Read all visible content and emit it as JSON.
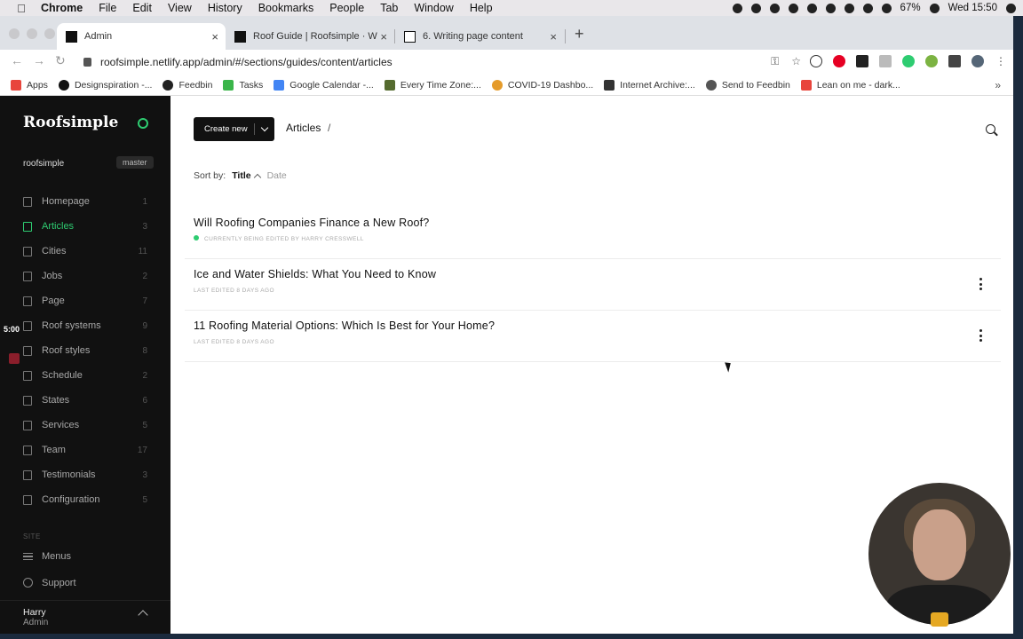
{
  "menubar": {
    "app": "Chrome",
    "items": [
      "File",
      "Edit",
      "View",
      "History",
      "Bookmarks",
      "People",
      "Tab",
      "Window",
      "Help"
    ],
    "battery": "67%",
    "clock": "Wed 15:50"
  },
  "tabs": [
    {
      "label": "Admin",
      "icon": "netlify-black-icon",
      "active": true
    },
    {
      "label": "Roof Guide | Roofsimple · We a",
      "icon": "roofsimple-icon",
      "active": false
    },
    {
      "label": "6. Writing page content",
      "icon": "notion-icon",
      "active": false
    }
  ],
  "omnibox": {
    "url": "roofsimple.netlify.app/admin/#/sections/guides/content/articles"
  },
  "bookmarks": [
    {
      "label": "Apps",
      "color": "#e8453c"
    },
    {
      "label": "Designspiration -...",
      "color": "#111111"
    },
    {
      "label": "Feedbin",
      "color": "#222222"
    },
    {
      "label": "Tasks",
      "color": "#3ab54a"
    },
    {
      "label": "Google Calendar -...",
      "color": "#4285f4"
    },
    {
      "label": "Every Time Zone:...",
      "color": "#556b2f"
    },
    {
      "label": "COVID-19 Dashbo...",
      "color": "#e59b2a"
    },
    {
      "label": "Internet Archive:...",
      "color": "#333333"
    },
    {
      "label": "Send to Feedbin",
      "color": "#555555"
    },
    {
      "label": "Lean on me - dark...",
      "color": "#e8453c"
    }
  ],
  "sidebar": {
    "logo": "Roofsimple",
    "site": "roofsimple",
    "branch": "master",
    "items": [
      {
        "label": "Homepage",
        "count": "1",
        "active": false
      },
      {
        "label": "Articles",
        "count": "3",
        "active": true
      },
      {
        "label": "Cities",
        "count": "11",
        "active": false
      },
      {
        "label": "Jobs",
        "count": "2",
        "active": false
      },
      {
        "label": "Page",
        "count": "7",
        "active": false
      },
      {
        "label": "Roof systems",
        "count": "9",
        "active": false
      },
      {
        "label": "Roof styles",
        "count": "8",
        "active": false
      },
      {
        "label": "Schedule",
        "count": "2",
        "active": false
      },
      {
        "label": "States",
        "count": "6",
        "active": false
      },
      {
        "label": "Services",
        "count": "5",
        "active": false
      },
      {
        "label": "Team",
        "count": "17",
        "active": false
      },
      {
        "label": "Testimonials",
        "count": "3",
        "active": false
      },
      {
        "label": "Configuration",
        "count": "5",
        "active": false
      }
    ],
    "section_label": "SITE",
    "menus_label": "Menus",
    "support_label": "Support",
    "user": {
      "name": "Harry",
      "role": "Admin"
    },
    "timer": "5:00"
  },
  "main": {
    "create_label": "Create new",
    "breadcrumb": "Articles",
    "breadcrumb_sep": "/",
    "sort_label": "Sort by:",
    "sort_title": "Title",
    "sort_date": "Date",
    "articles": [
      {
        "title": "Will Roofing Companies Finance a New Roof?",
        "meta": "Currently being edited by Harry Cresswell",
        "editing": true
      },
      {
        "title": "Ice and Water Shields: What You Need to Know",
        "meta": "Last edited 8 days ago",
        "editing": false
      },
      {
        "title": "11 Roofing Material Options: Which Is Best for Your Home?",
        "meta": "Last edited 8 days ago",
        "editing": false
      }
    ]
  },
  "colors": {
    "accent": "#2ecc71",
    "sidebar_bg": "#111111"
  }
}
